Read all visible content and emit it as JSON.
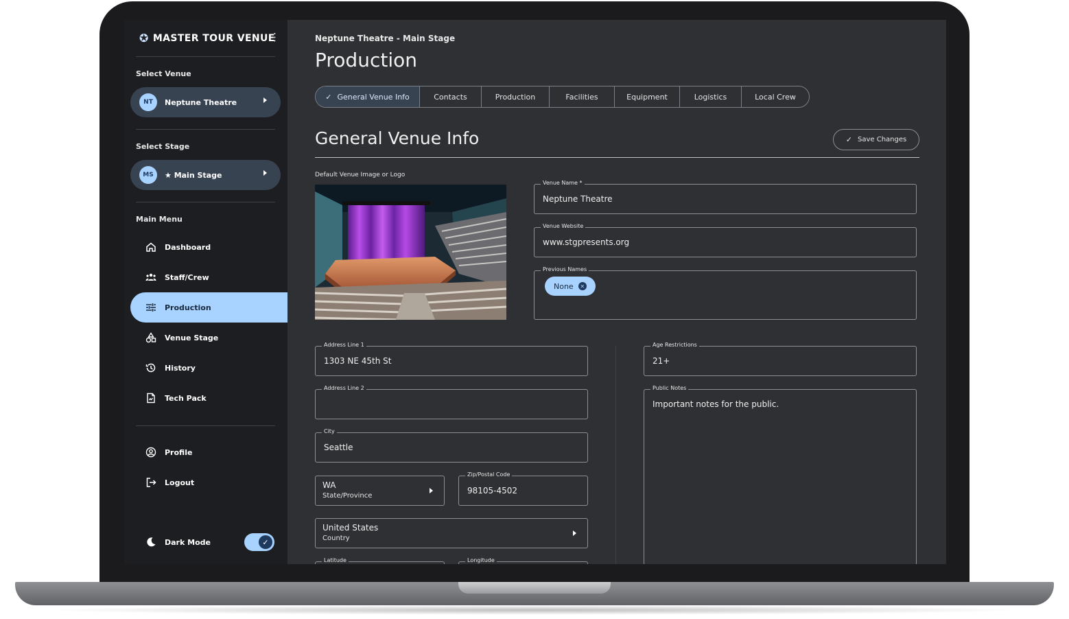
{
  "app": {
    "brand": "MASTER TOUR VENUE"
  },
  "sidebar": {
    "select_venue_label": "Select Venue",
    "venue": {
      "initials": "NT",
      "name": "Neptune Theatre"
    },
    "select_stage_label": "Select Stage",
    "stage": {
      "initials": "MS",
      "name": "★ Main Stage"
    },
    "main_menu_label": "Main Menu",
    "menu": [
      {
        "label": "Dashboard",
        "icon": "home-icon"
      },
      {
        "label": "Staff/Crew",
        "icon": "people-icon"
      },
      {
        "label": "Production",
        "icon": "sliders-icon",
        "active": true
      },
      {
        "label": "Venue Stage",
        "icon": "shapes-icon"
      },
      {
        "label": "History",
        "icon": "history-icon"
      },
      {
        "label": "Tech Pack",
        "icon": "document-icon"
      }
    ],
    "account": [
      {
        "label": "Profile",
        "icon": "profile-icon"
      },
      {
        "label": "Logout",
        "icon": "logout-icon"
      }
    ],
    "dark_mode_label": "Dark Mode",
    "dark_mode_on": true
  },
  "header": {
    "breadcrumb": "Neptune Theatre - Main Stage",
    "title": "Production"
  },
  "tabs": [
    {
      "label": "General Venue Info",
      "active": true
    },
    {
      "label": "Contacts"
    },
    {
      "label": "Production"
    },
    {
      "label": "Facilities"
    },
    {
      "label": "Equipment"
    },
    {
      "label": "Logistics"
    },
    {
      "label": "Local Crew"
    }
  ],
  "section": {
    "title": "General Venue Info",
    "save_label": "Save Changes",
    "image_label": "Default Venue Image or Logo"
  },
  "form": {
    "venue_name": {
      "label": "Venue Name *",
      "value": "Neptune Theatre"
    },
    "venue_website": {
      "label": "Venue Website",
      "value": "www.stgpresents.org"
    },
    "previous_names": {
      "label": "Previous Names",
      "chip": "None"
    },
    "address1": {
      "label": "Address Line 1",
      "value": "1303 NE 45th St"
    },
    "address2": {
      "label": "Address Line 2",
      "value": ""
    },
    "city": {
      "label": "City",
      "value": "Seattle"
    },
    "state": {
      "value": "WA",
      "sublabel": "State/Province"
    },
    "zip": {
      "label": "Zip/Postal Code",
      "value": "98105-4502"
    },
    "country": {
      "value": "United States",
      "sublabel": "Country"
    },
    "latitude": {
      "label": "Latitude"
    },
    "longitude": {
      "label": "Longitude"
    },
    "age": {
      "label": "Age Restrictions",
      "value": "21+"
    },
    "public_notes": {
      "label": "Public Notes",
      "value": "Important notes for the public."
    }
  },
  "colors": {
    "accent": "#a8d2ff",
    "sidebar_bg": "#1d1e21",
    "main_bg": "#2e3033",
    "selector_bg": "#384352"
  }
}
